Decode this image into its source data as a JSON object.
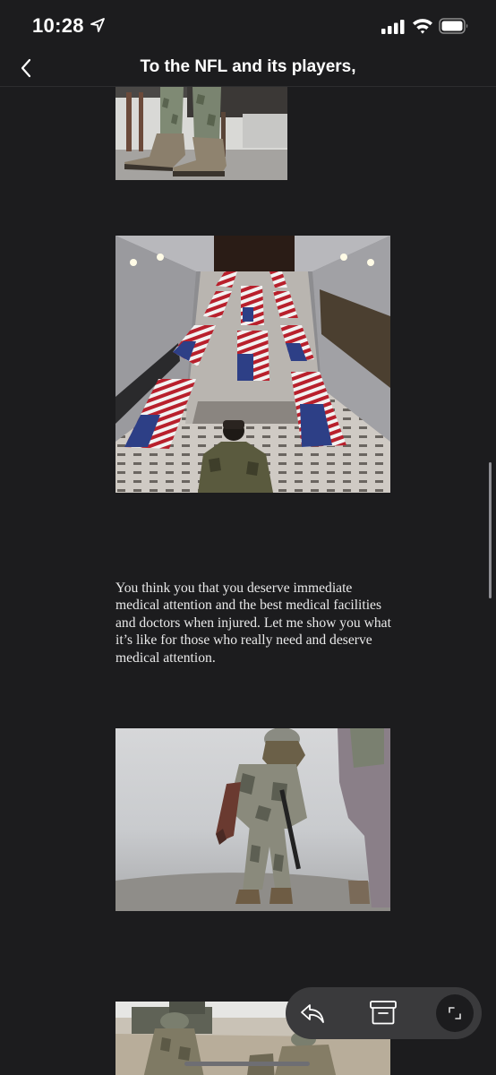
{
  "status_bar": {
    "time": "10:28",
    "icons": [
      "location-arrow-icon",
      "cellular-signal-icon",
      "wifi-icon",
      "battery-icon"
    ]
  },
  "nav": {
    "title": "To the NFL and its players,",
    "back_icon": "chevron-left-icon"
  },
  "article": {
    "paragraph": "You think you that you deserve immediate medical attention and the best medical facilities and doctors when injured. Let me show you what it’s like for those who really need and deserve medical attention.",
    "images": [
      "soldier-boots-photo",
      "flag-draped-coffins-photo",
      "wounded-soldier-photo",
      "soldiers-group-photo"
    ]
  },
  "actions": {
    "icons": [
      "reply-icon",
      "archive-icon",
      "expand-icon"
    ]
  },
  "colors": {
    "background": "#1c1c1e",
    "pill": "#3a3a3c",
    "text": "#e9e9e9"
  }
}
